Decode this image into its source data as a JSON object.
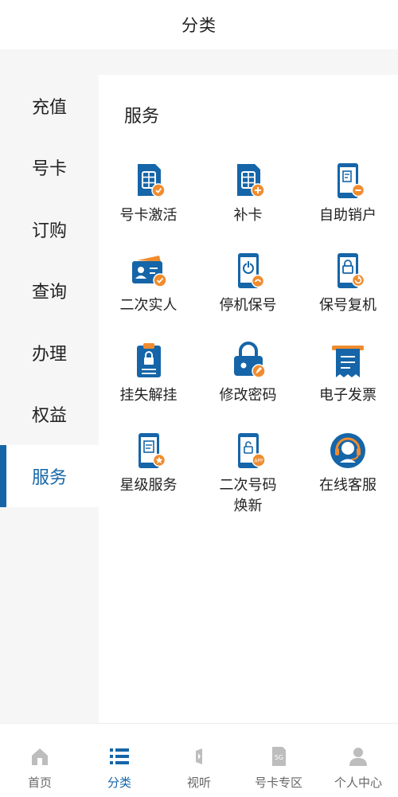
{
  "header": {
    "title": "分类"
  },
  "sidebar": {
    "items": [
      {
        "label": "充值",
        "active": false
      },
      {
        "label": "号卡",
        "active": false
      },
      {
        "label": "订购",
        "active": false
      },
      {
        "label": "查询",
        "active": false
      },
      {
        "label": "办理",
        "active": false
      },
      {
        "label": "权益",
        "active": false
      },
      {
        "label": "服务",
        "active": true
      }
    ]
  },
  "content": {
    "section_title": "服务",
    "services": [
      {
        "label": "号卡激活",
        "icon": "sim-card-activate-icon"
      },
      {
        "label": "补卡",
        "icon": "sim-card-replace-icon"
      },
      {
        "label": "自助销户",
        "icon": "phone-cancel-account-icon"
      },
      {
        "label": "二次实人",
        "icon": "id-card-verify-icon"
      },
      {
        "label": "停机保号",
        "icon": "phone-power-icon"
      },
      {
        "label": "保号复机",
        "icon": "phone-restore-icon"
      },
      {
        "label": "挂失解挂",
        "icon": "clipboard-lock-icon"
      },
      {
        "label": "修改密码",
        "icon": "padlock-edit-icon"
      },
      {
        "label": "电子发票",
        "icon": "receipt-icon"
      },
      {
        "label": "星级服务",
        "icon": "phone-star-icon"
      },
      {
        "label": "二次号码\n焕新",
        "icon": "phone-app-lock-icon"
      },
      {
        "label": "在线客服",
        "icon": "headset-agent-icon"
      }
    ]
  },
  "tabbar": {
    "items": [
      {
        "label": "首页",
        "icon": "home-icon",
        "active": false
      },
      {
        "label": "分类",
        "icon": "list-icon",
        "active": true
      },
      {
        "label": "视听",
        "icon": "media-icon",
        "active": false
      },
      {
        "label": "号卡专区",
        "icon": "5g-sim-icon",
        "active": false
      },
      {
        "label": "个人中心",
        "icon": "user-icon",
        "active": false
      }
    ]
  },
  "colors": {
    "brand_blue": "#1565a8",
    "accent_orange": "#f08c2e",
    "inactive_gray": "#bdbdbd"
  }
}
